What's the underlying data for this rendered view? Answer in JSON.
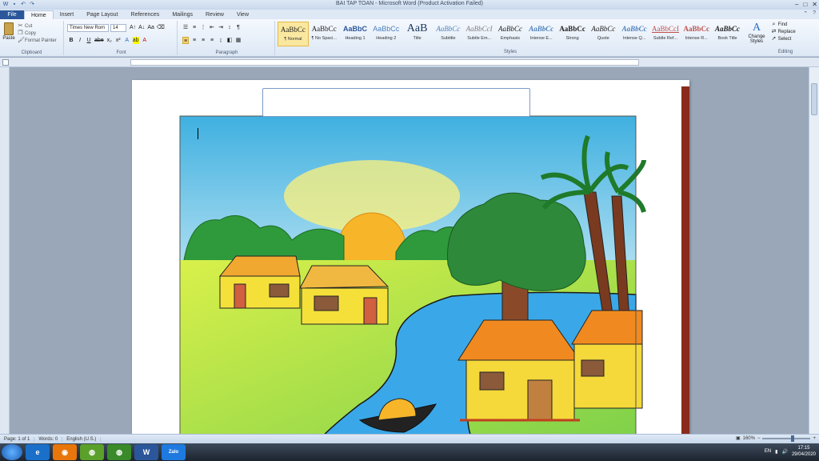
{
  "window": {
    "title": "BAI TAP TOAN - Microsoft Word (Product Activation Failed)"
  },
  "tabs": [
    {
      "label": "File"
    },
    {
      "label": "Home"
    },
    {
      "label": "Insert"
    },
    {
      "label": "Page Layout"
    },
    {
      "label": "References"
    },
    {
      "label": "Mailings"
    },
    {
      "label": "Review"
    },
    {
      "label": "View"
    }
  ],
  "ribbon": {
    "clipboard": {
      "paste": "Paste",
      "cut": "Cut",
      "copy": "Copy",
      "format_painter": "Format Painter",
      "label": "Clipboard"
    },
    "font": {
      "name": "Times New Rom",
      "size": "14",
      "label": "Font",
      "bold": "B",
      "italic": "I",
      "underline": "U",
      "strike": "abe",
      "subscript": "x₂",
      "superscript": "x²"
    },
    "paragraph": {
      "label": "Paragraph"
    },
    "styles": {
      "label": "Styles",
      "items": [
        {
          "sample": "AaBbCc",
          "name": "¶ Normal"
        },
        {
          "sample": "AaBbCc",
          "name": "¶ No Spaci..."
        },
        {
          "sample": "AaBbC",
          "name": "Heading 1"
        },
        {
          "sample": "AaBbCc",
          "name": "Heading 2"
        },
        {
          "sample": "AaB",
          "name": "Title"
        },
        {
          "sample": "AaBbCc",
          "name": "Subtitle"
        },
        {
          "sample": "AaBbCcI",
          "name": "Subtle Em..."
        },
        {
          "sample": "AaBbCc",
          "name": "Emphasis"
        },
        {
          "sample": "AaBbCc",
          "name": "Intense E..."
        },
        {
          "sample": "AaBbCc",
          "name": "Strong"
        },
        {
          "sample": "AaBbCc",
          "name": "Quote"
        },
        {
          "sample": "AaBbCc",
          "name": "Intense Q..."
        },
        {
          "sample": "AaBbCcI",
          "name": "Subtle Ref..."
        },
        {
          "sample": "AaBbCc",
          "name": "Intense R..."
        },
        {
          "sample": "AaBbCc",
          "name": "Book Title"
        }
      ],
      "change_styles": "Change Styles"
    },
    "editing": {
      "label": "Editing",
      "find": "Find",
      "replace": "Replace",
      "select": "Select"
    }
  },
  "status": {
    "page": "Page: 1 of 1",
    "words": "Words: 0",
    "language": "English (U.S.)",
    "zoom": "160%"
  },
  "taskbar": {
    "lang": "EN",
    "time": "17:15",
    "date": "29/04/2020",
    "zalo": "Zalo"
  },
  "colors": {
    "file_tab": "#2b579a",
    "selected_style": "#fbe8a0"
  }
}
